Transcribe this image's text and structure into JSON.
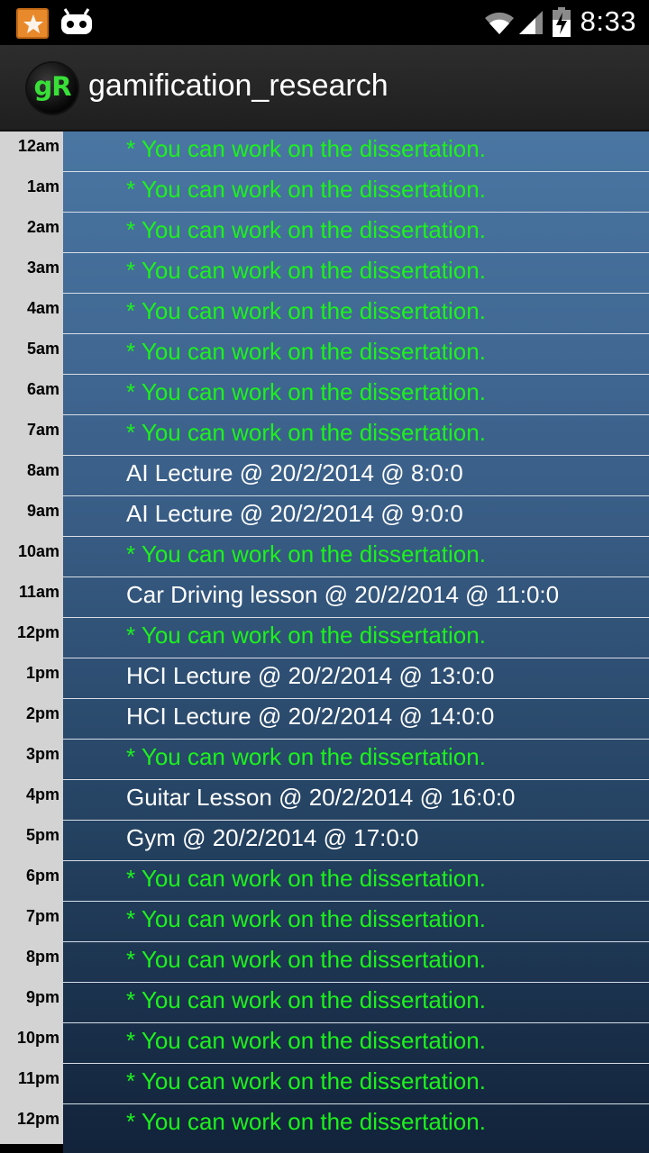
{
  "status_bar": {
    "time": "8:33",
    "icons": [
      "notification-app-icon",
      "android-robot-icon",
      "wifi-icon",
      "signal-icon",
      "battery-charging-icon"
    ]
  },
  "action_bar": {
    "logo_text": "gR",
    "title": "gamification_research"
  },
  "colors": {
    "free_slot_text": "#1cf21c",
    "busy_slot_text": "#ffffff",
    "hour_column_bg": "#d3d3d3"
  },
  "schedule": [
    {
      "hour": "12am",
      "text": "* You can work on the dissertation.",
      "kind": "free"
    },
    {
      "hour": "1am",
      "text": "* You can work on the dissertation.",
      "kind": "free"
    },
    {
      "hour": "2am",
      "text": "* You can work on the dissertation.",
      "kind": "free"
    },
    {
      "hour": "3am",
      "text": "* You can work on the dissertation.",
      "kind": "free"
    },
    {
      "hour": "4am",
      "text": "* You can work on the dissertation.",
      "kind": "free"
    },
    {
      "hour": "5am",
      "text": "* You can work on the dissertation.",
      "kind": "free"
    },
    {
      "hour": "6am",
      "text": "* You can work on the dissertation.",
      "kind": "free"
    },
    {
      "hour": "7am",
      "text": "* You can work on the dissertation.",
      "kind": "free"
    },
    {
      "hour": "8am",
      "text": "AI Lecture @ 20/2/2014 @ 8:0:0",
      "kind": "busy"
    },
    {
      "hour": "9am",
      "text": "AI Lecture @ 20/2/2014 @ 9:0:0",
      "kind": "busy"
    },
    {
      "hour": "10am",
      "text": "* You can work on the dissertation.",
      "kind": "free"
    },
    {
      "hour": "11am",
      "text": "Car Driving lesson @ 20/2/2014 @ 11:0:0",
      "kind": "busy"
    },
    {
      "hour": "12pm",
      "text": "* You can work on the dissertation.",
      "kind": "free"
    },
    {
      "hour": "1pm",
      "text": "HCI Lecture @ 20/2/2014 @ 13:0:0",
      "kind": "busy"
    },
    {
      "hour": "2pm",
      "text": "HCI Lecture @ 20/2/2014 @ 14:0:0",
      "kind": "busy"
    },
    {
      "hour": "3pm",
      "text": "* You can work on the dissertation.",
      "kind": "free"
    },
    {
      "hour": "4pm",
      "text": "Guitar Lesson @ 20/2/2014 @ 16:0:0",
      "kind": "busy"
    },
    {
      "hour": "5pm",
      "text": "Gym @ 20/2/2014 @ 17:0:0",
      "kind": "busy"
    },
    {
      "hour": "6pm",
      "text": "* You can work on the dissertation.",
      "kind": "free"
    },
    {
      "hour": "7pm",
      "text": "* You can work on the dissertation.",
      "kind": "free"
    },
    {
      "hour": "8pm",
      "text": "* You can work on the dissertation.",
      "kind": "free"
    },
    {
      "hour": "9pm",
      "text": "* You can work on the dissertation.",
      "kind": "free"
    },
    {
      "hour": "10pm",
      "text": "* You can work on the dissertation.",
      "kind": "free"
    },
    {
      "hour": "11pm",
      "text": "* You can work on the dissertation.",
      "kind": "free"
    },
    {
      "hour": "12pm",
      "text": "* You can work on the dissertation.",
      "kind": "free"
    }
  ]
}
